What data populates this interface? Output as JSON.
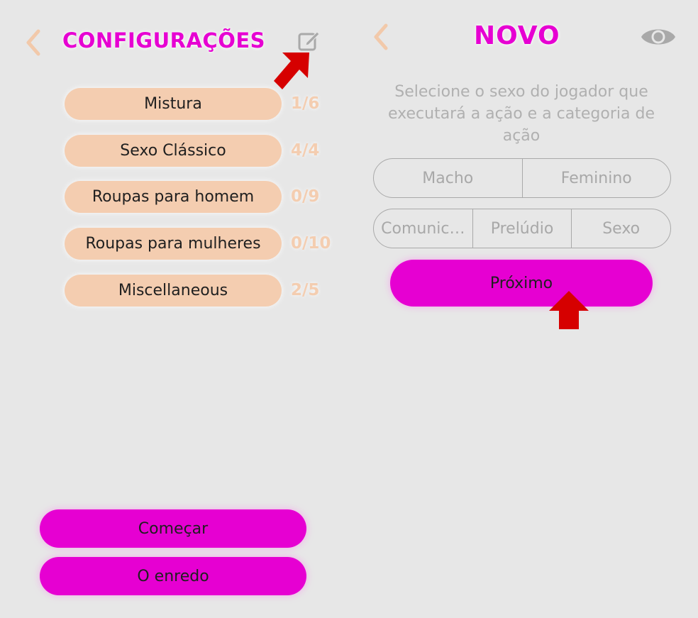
{
  "left_screen": {
    "title": "CONFIGURAÇÕES",
    "back_icon": "chevron-left-icon",
    "edit_icon": "edit-icon",
    "categories": [
      {
        "label": "Mistura",
        "count": "1/6"
      },
      {
        "label": "Sexo Clássico",
        "count": "4/4"
      },
      {
        "label": "Roupas para homem",
        "count": "0/9"
      },
      {
        "label": "Roupas para mulheres",
        "count": "0/10"
      },
      {
        "label": "Miscellaneous",
        "count": "2/5"
      }
    ],
    "start_button": "Começar",
    "story_button": "O enredo"
  },
  "right_screen": {
    "title": "NOVO",
    "back_icon": "chevron-left-icon",
    "view_icon": "eye-icon",
    "instructions": "Selecione o sexo do jogador que executará a ação e a categoria de ação",
    "gender_options": [
      "Macho",
      "Feminino"
    ],
    "category_options": [
      "Comunic…",
      "Prelúdio",
      "Sexo"
    ],
    "next_button": "Próximo"
  },
  "annotations": {
    "arrow_icon": "red-arrow-icon",
    "arrow_color": "#d60000"
  },
  "colors": {
    "background": "#e7e7e7",
    "accent_magenta": "#e600d2",
    "peach": "#f4cdb0",
    "muted_text": "#b0b0b0",
    "chevron": "#f2c9aa",
    "icon_gray": "#a9a9a9"
  }
}
